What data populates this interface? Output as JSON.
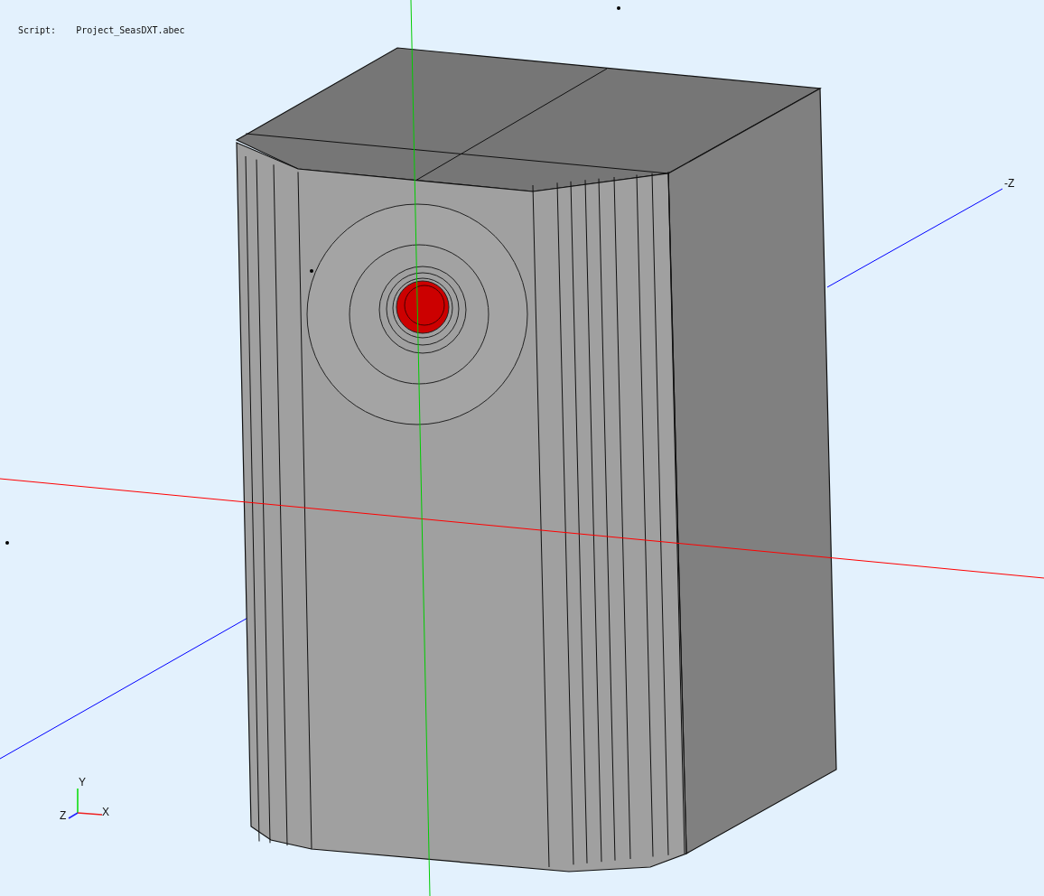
{
  "info": {
    "label": "Script:",
    "value": "Project_SeasDXT.abec"
  },
  "axis_label": "-Z",
  "gizmo": {
    "y": "Y",
    "z": "Z",
    "x": "X"
  }
}
